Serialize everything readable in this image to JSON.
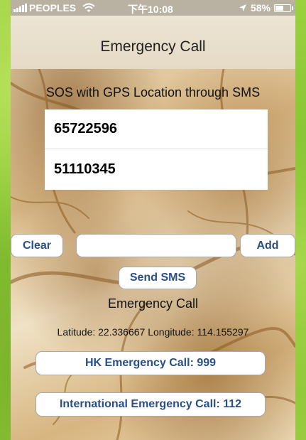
{
  "status": {
    "carrier": "PEOPLES",
    "time": "下午10:08",
    "battery_text": "58%",
    "battery_level": 0.58
  },
  "nav": {
    "title": "Emergency Call"
  },
  "main": {
    "subtitle": "SOS with GPS Location through SMS",
    "numbers": [
      "65722596",
      "51110345"
    ],
    "clear_label": "Clear",
    "phone_input_value": "",
    "add_label": "Add",
    "send_sms_label": "Send SMS",
    "section_label": "Emergency Call",
    "location_text": "Latitude: 22.336667 Longitude: 114.155297",
    "hk_call_label": "HK Emergency Call: 999",
    "intl_call_label": "International Emergency Call: 112"
  },
  "colors": {
    "accent_text": "#2a4f86",
    "side_background": "#8fc93a"
  },
  "icons": [
    "signal-bars-icon",
    "wifi-icon",
    "location-arrow-icon",
    "battery-icon"
  ]
}
